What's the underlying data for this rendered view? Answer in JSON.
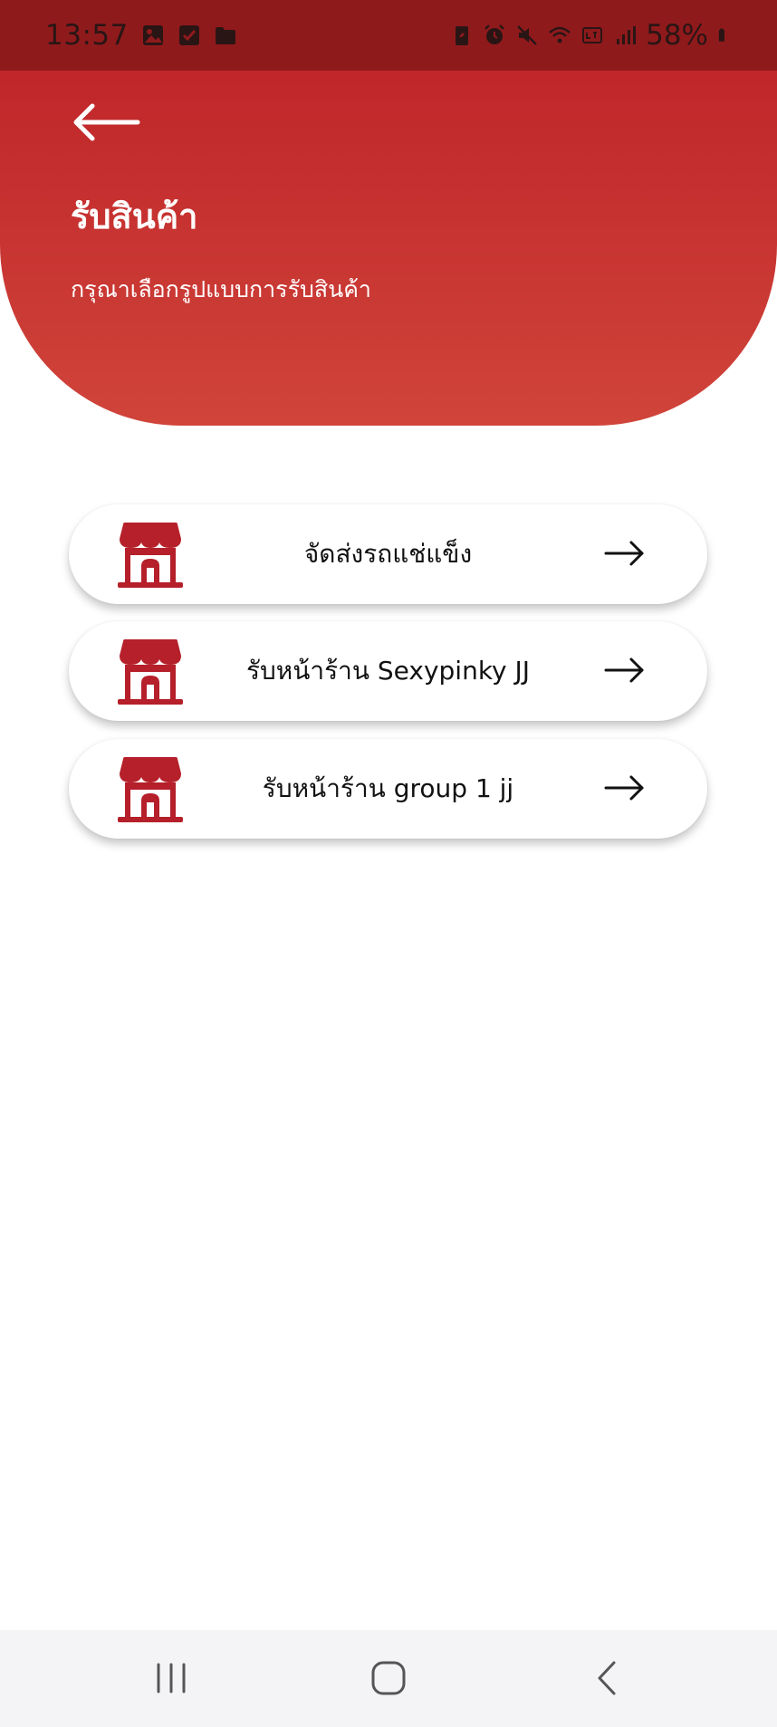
{
  "status_bar": {
    "time": "13:57",
    "battery_percent": "58%",
    "icons_left": [
      "gallery-icon",
      "checkbox-icon",
      "folder-icon"
    ],
    "icons_right": [
      "battery-saver-icon",
      "alarm-icon",
      "mute-icon",
      "wifi-icon",
      "volte-icon",
      "signal-icon",
      "battery-icon"
    ]
  },
  "header": {
    "title": "รับสินค้า",
    "subtitle": "กรุณาเลือกรูปแบบการรับสินค้า",
    "back_icon": "arrow-left-icon"
  },
  "options": [
    {
      "label": "จัดส่งรถแช่แข็ง",
      "icon": "store-icon",
      "action_icon": "arrow-right-icon"
    },
    {
      "label": "รับหน้าร้าน Sexypinky JJ",
      "icon": "store-icon",
      "action_icon": "arrow-right-icon"
    },
    {
      "label": "รับหน้าร้าน group 1 jj",
      "icon": "store-icon",
      "action_icon": "arrow-right-icon"
    }
  ],
  "nav_bar": {
    "buttons": [
      "recent-apps-icon",
      "home-icon",
      "back-icon"
    ]
  },
  "colors": {
    "status_bar": "#8f1a1c",
    "header_top": "#c0262a",
    "header_bottom": "#d0443a",
    "store_icon": "#b5202a"
  }
}
